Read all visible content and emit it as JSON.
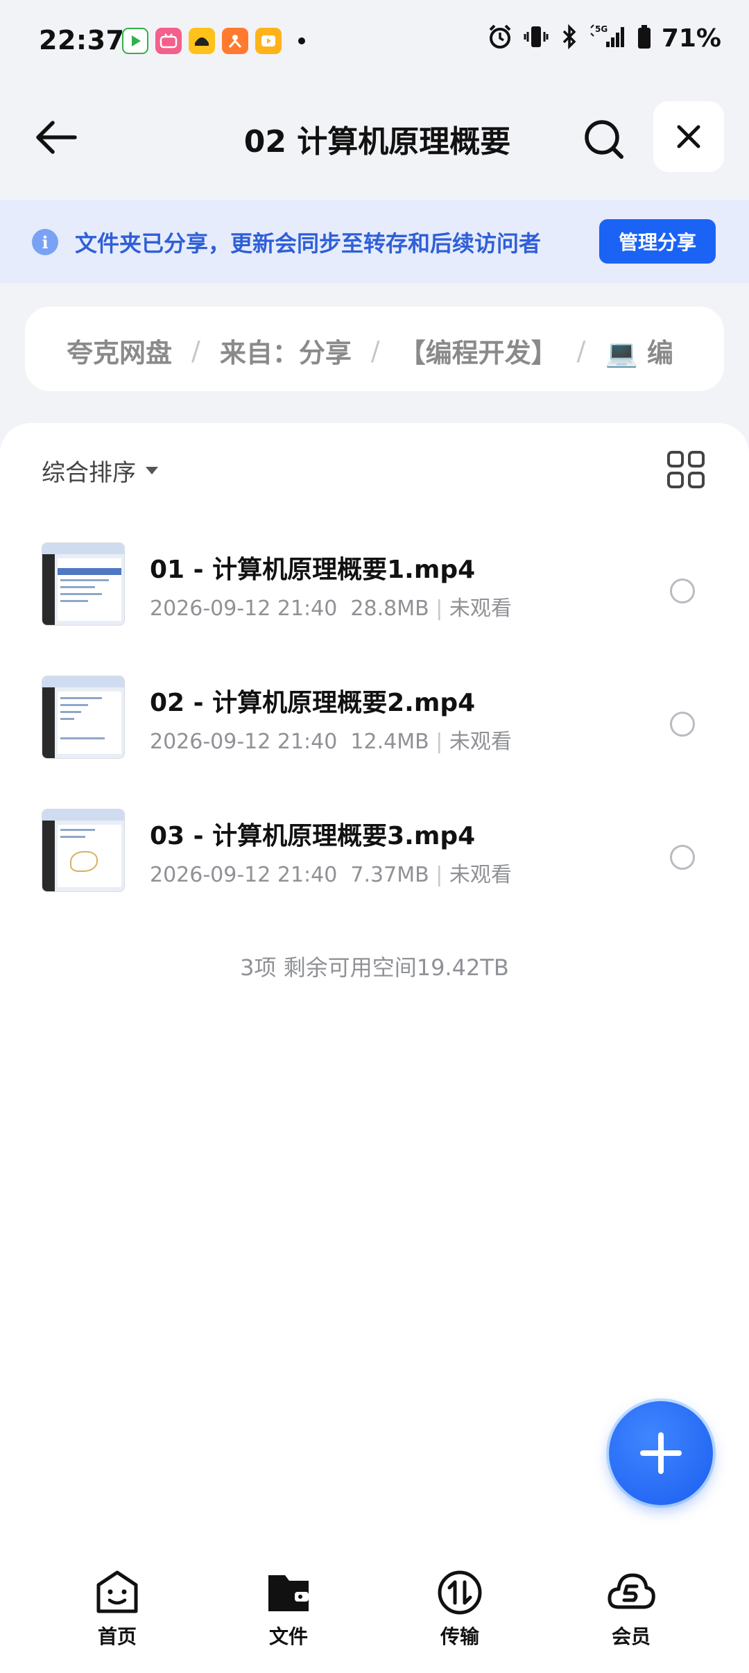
{
  "status_bar": {
    "time": "22:37",
    "battery": "71%",
    "notification_apps": [
      "video-app-icon",
      "bilibili-icon",
      "car-app-icon",
      "orange-app-icon",
      "player-app-icon"
    ],
    "system_icons": [
      "alarm-icon",
      "vibrate-icon",
      "bluetooth-icon",
      "5g-signal-icon",
      "battery-icon"
    ]
  },
  "header": {
    "title": "02 计算机原理概要"
  },
  "share_banner": {
    "text": "文件夹已分享，更新会同步至转存和后续访问者",
    "button_label": "管理分享",
    "info_glyph": "i"
  },
  "breadcrumb": {
    "items": [
      "夸克网盘",
      "来自：分享",
      "【编程开发】",
      "💻 编"
    ]
  },
  "toolbar": {
    "sort_label": "综合排序"
  },
  "files": [
    {
      "name": "01 - 计算机原理概要1.mp4",
      "date": "2026-09-12 21:40",
      "size": "28.8MB",
      "status": "未观看"
    },
    {
      "name": "02 - 计算机原理概要2.mp4",
      "date": "2026-09-12 21:40",
      "size": "12.4MB",
      "status": "未观看"
    },
    {
      "name": "03 - 计算机原理概要3.mp4",
      "date": "2026-09-12 21:40",
      "size": "7.37MB",
      "status": "未观看"
    }
  ],
  "footer": {
    "summary": "3项 剩余可用空间19.42TB"
  },
  "bottom_nav": {
    "items": [
      {
        "label": "首页",
        "icon": "home-face-icon"
      },
      {
        "label": "文件",
        "icon": "folder-icon"
      },
      {
        "label": "传输",
        "icon": "transfer-icon"
      },
      {
        "label": "会员",
        "icon": "vip-cloud-icon"
      }
    ]
  },
  "colors": {
    "accent": "#1b63f5",
    "banner_bg": "#e6ecfb",
    "banner_text": "#2f5fd8",
    "page_bg": "#f2f3f7"
  }
}
